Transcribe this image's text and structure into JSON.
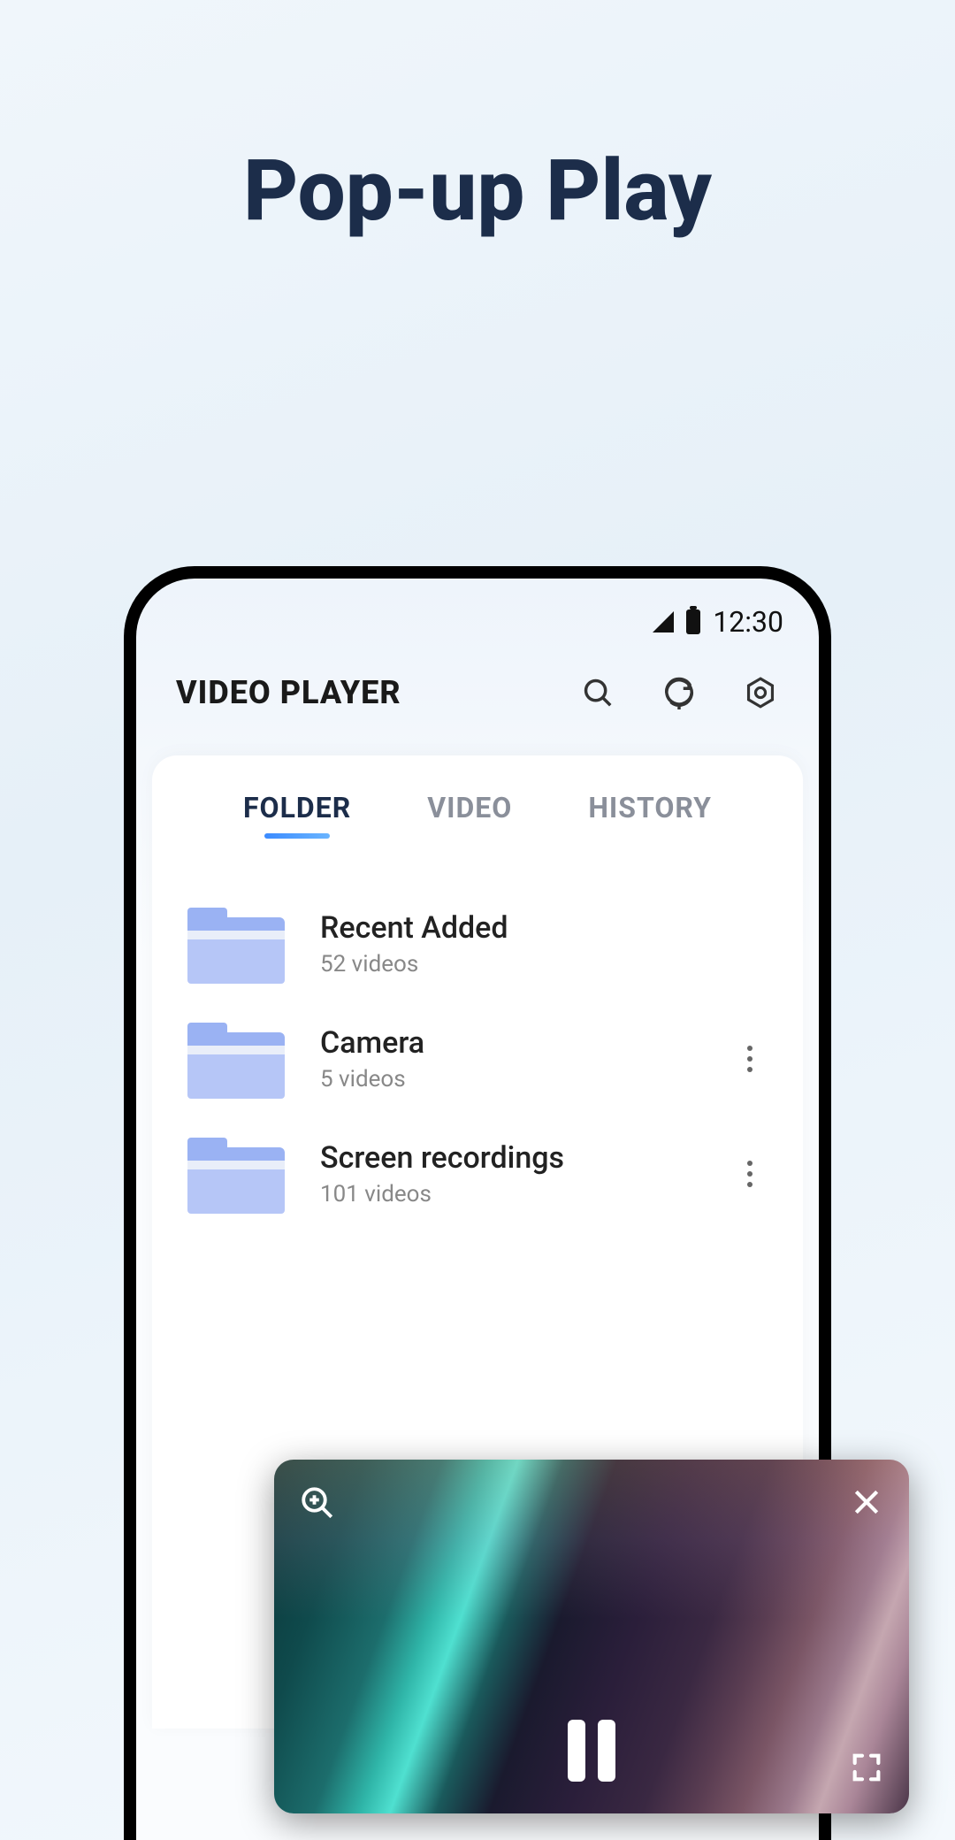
{
  "page_title": "Pop-up Play",
  "statusbar": {
    "time": "12:30"
  },
  "appbar": {
    "title": "VIDEO PLAYER",
    "icons": {
      "search": "search-icon",
      "refresh": "refresh-icon",
      "settings": "settings-icon"
    }
  },
  "tabs": [
    {
      "label": "FOLDER",
      "active": true
    },
    {
      "label": "VIDEO",
      "active": false
    },
    {
      "label": "HISTORY",
      "active": false
    }
  ],
  "folders": [
    {
      "name": "Recent Added",
      "count": "52 videos",
      "show_more": false
    },
    {
      "name": "Camera",
      "count": "5 videos",
      "show_more": true
    },
    {
      "name": "Screen recordings",
      "count": "101 videos",
      "show_more": true
    }
  ],
  "popup": {
    "zoom_icon": "zoom-in-icon",
    "close_icon": "close-icon",
    "pause_icon": "pause-icon",
    "fullscreen_icon": "fullscreen-icon"
  }
}
